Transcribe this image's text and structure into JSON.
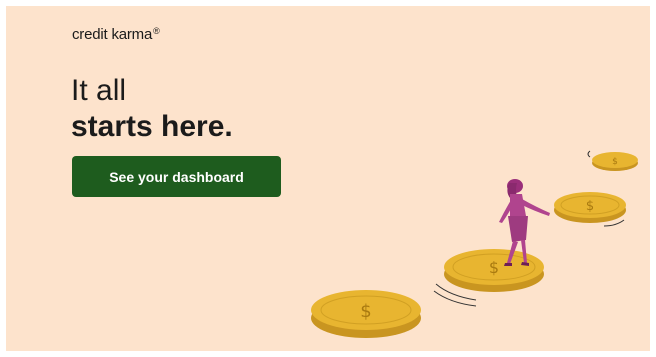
{
  "brand": {
    "name": "credit karma",
    "mark": "®"
  },
  "headline": {
    "line1": "It all",
    "line2": "starts here."
  },
  "cta": {
    "label": "See your dashboard"
  },
  "colors": {
    "background": "#fde3cc",
    "button": "#1e5c1e",
    "coin": "#e8b530",
    "coin_edge": "#b8860b",
    "figure": "#b0448e"
  },
  "illustration": {
    "subject": "person-walking-on-dollar-coins-icon",
    "coin_symbol": "$",
    "coin_count": 4
  }
}
